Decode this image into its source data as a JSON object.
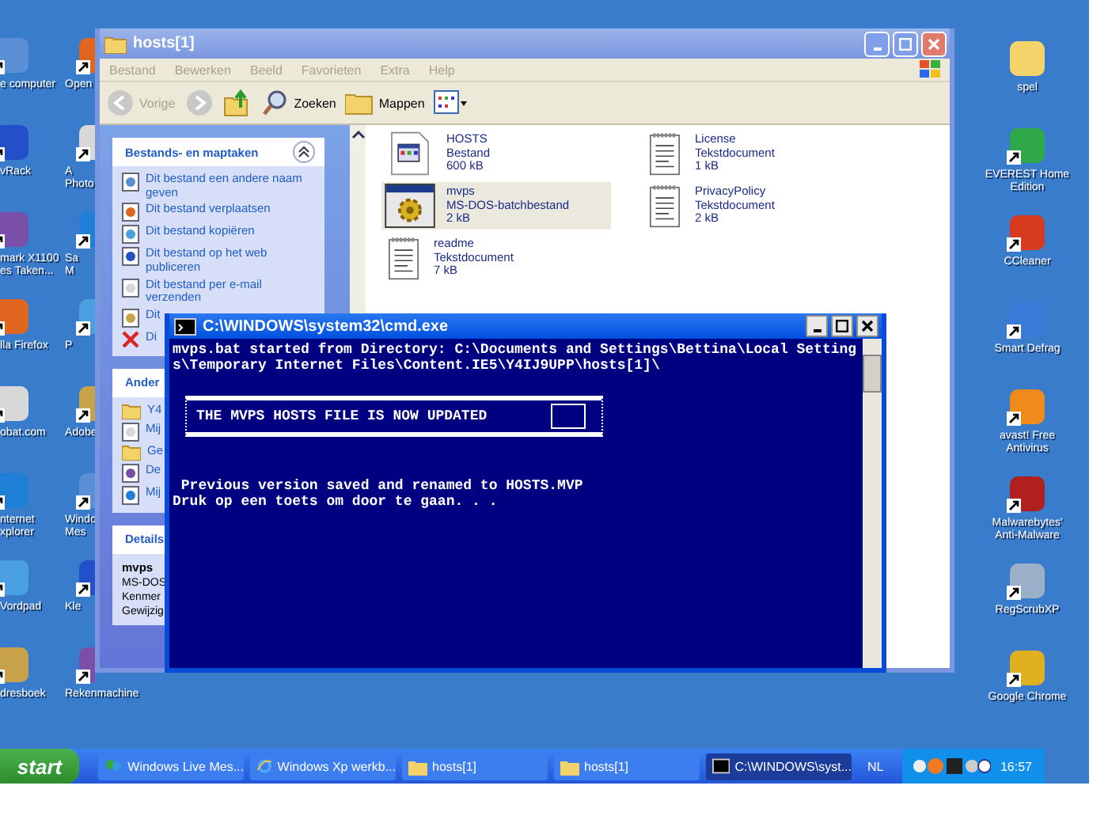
{
  "desktop_icons": {
    "column_1": [
      "e computer",
      "vRack",
      "mark X1100\nes Taken...",
      "lla Firefox",
      "obat.com",
      "nternet\nxplorer",
      "Vordpad",
      "dresboek"
    ],
    "column_2": [
      "Open",
      "A\nPhoto",
      "Sa\nM",
      "P",
      "Adobe",
      "Windo\nMes",
      "Kle",
      "Rekenmachine"
    ],
    "column_3": [
      "spel",
      "EVEREST Home\nEdition",
      "CCleaner",
      "Smart Defrag",
      "avast! Free\nAntivirus",
      "Malwarebytes'\nAnti-Malware",
      "RegScrubXP",
      "Google Chrome"
    ]
  },
  "explorer": {
    "title": "hosts[1]",
    "menu": [
      "Bestand",
      "Bewerken",
      "Beeld",
      "Favorieten",
      "Extra",
      "Help"
    ],
    "toolbar": [
      {
        "label": "Vorige",
        "disabled": true
      },
      {
        "label": "Zoeken",
        "disabled": false
      },
      {
        "label": "Mappen",
        "disabled": false
      }
    ],
    "task_panels": [
      {
        "title": "Bestands- en maptaken",
        "items": [
          {
            "label": "Dit bestand een andere naam geven",
            "kind": "link"
          },
          {
            "label": "Dit bestand verplaatsen",
            "kind": "link"
          },
          {
            "label": "Dit bestand kopiëren",
            "kind": "link"
          },
          {
            "label": "Dit bestand op het web publiceren",
            "kind": "link"
          },
          {
            "label": "Dit bestand per e-mail verzenden",
            "kind": "link"
          },
          {
            "label": "Dit",
            "kind": "link"
          },
          {
            "label": "Di",
            "kind": "delete"
          }
        ]
      },
      {
        "title": "Ander",
        "items": [
          {
            "label": "Y4",
            "kind": "link"
          },
          {
            "label": "Mij",
            "kind": "link"
          },
          {
            "label": "Ge",
            "kind": "link"
          },
          {
            "label": "De",
            "kind": "link"
          },
          {
            "label": "Mij",
            "kind": "link"
          }
        ]
      },
      {
        "title": "Details",
        "items": [
          {
            "label": "mvps",
            "kind": "name"
          },
          {
            "label": "MS-DOS",
            "kind": "text"
          },
          {
            "label": "Kenmer",
            "kind": "text"
          },
          {
            "label": "Gewijzig",
            "kind": "text"
          }
        ]
      }
    ],
    "files": [
      {
        "name": "HOSTS",
        "type": "Bestand",
        "size": "600 kB",
        "kind": "system",
        "selected": false
      },
      {
        "name": "License",
        "type": "Tekstdocument",
        "size": "1 kB",
        "kind": "text",
        "selected": false
      },
      {
        "name": "mvps",
        "type": "MS-DOS-batchbestand",
        "size": "2 kB",
        "kind": "batch",
        "selected": true
      },
      {
        "name": "PrivacyPolicy",
        "type": "Tekstdocument",
        "size": "2 kB",
        "kind": "text",
        "selected": false
      },
      {
        "name": "readme",
        "type": "Tekstdocument",
        "size": "7 kB",
        "kind": "text",
        "selected": false
      }
    ]
  },
  "console": {
    "title": "C:\\WINDOWS\\system32\\cmd.exe",
    "lines": [
      "mvps.bat started from Directory: C:\\Documents and Settings\\Bettina\\Local Setting",
      "s\\Temporary Internet Files\\Content.IE5\\Y4IJ9UPP\\hosts[1]\\"
    ],
    "banner": "THE MVPS HOSTS FILE IS NOW UPDATED",
    "after": [
      " Previous version saved and renamed to HOSTS.MVP",
      "Druk op een toets om door te gaan. . ."
    ]
  },
  "taskbar": {
    "start": "start",
    "buttons": [
      {
        "label": "Windows Live Mes...",
        "kind": "messenger",
        "selected": false
      },
      {
        "label": "Windows Xp werkb...",
        "kind": "browser",
        "selected": false
      },
      {
        "label": "hosts[1]",
        "kind": "folder",
        "selected": false
      },
      {
        "label": "hosts[1]",
        "kind": "folder",
        "selected": false
      },
      {
        "label": "C:\\WINDOWS\\syst...",
        "kind": "console",
        "selected": true
      }
    ],
    "language": "NL",
    "clock": "16:57"
  }
}
